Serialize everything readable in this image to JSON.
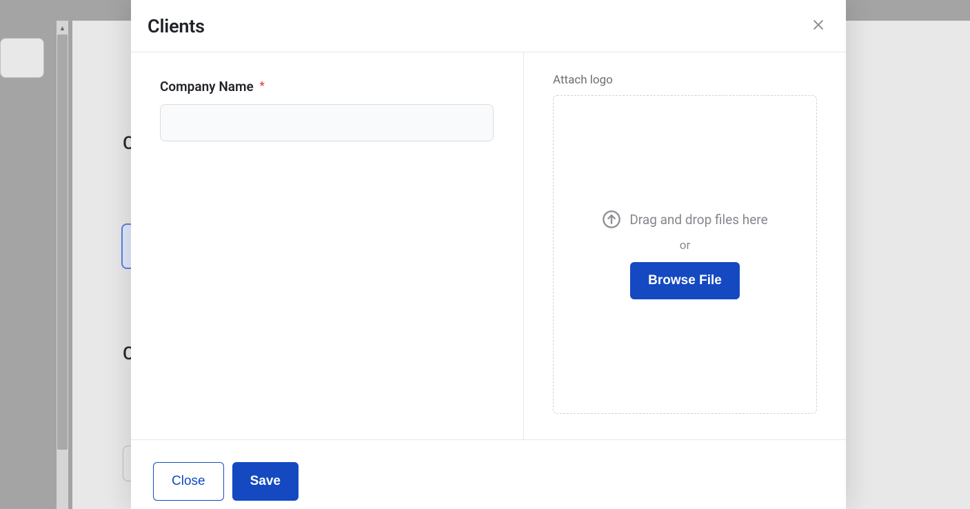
{
  "modal": {
    "title": "Clients",
    "left": {
      "company_name_label": "Company Name",
      "company_name_value": ""
    },
    "right": {
      "attach_label": "Attach logo",
      "drag_text": "Drag and drop files here",
      "or_text": "or",
      "browse_label": "Browse File"
    },
    "footer": {
      "close_label": "Close",
      "save_label": "Save"
    }
  },
  "background": {
    "letter_1": "C",
    "letter_2": "C"
  }
}
